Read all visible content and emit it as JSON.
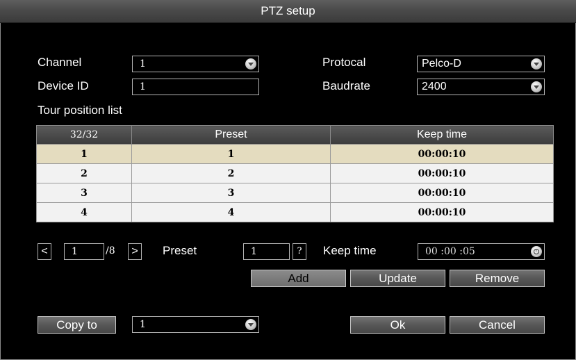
{
  "window": {
    "title": "PTZ setup"
  },
  "form": {
    "channel_label": "Channel",
    "channel_value": "1",
    "device_id_label": "Device ID",
    "device_id_value": "1",
    "protocol_label": "Protocal",
    "protocol_value": "Pelco-D",
    "baudrate_label": "Baudrate",
    "baudrate_value": "2400"
  },
  "tour": {
    "list_label": "Tour position list",
    "columns": [
      "32/32",
      "Preset",
      "Keep time"
    ],
    "rows": [
      {
        "index": "1",
        "preset": "1",
        "keep_time": "00:00:10",
        "selected": true
      },
      {
        "index": "2",
        "preset": "2",
        "keep_time": "00:00:10"
      },
      {
        "index": "3",
        "preset": "3",
        "keep_time": "00:00:10"
      },
      {
        "index": "4",
        "preset": "4",
        "keep_time": "00:00:10"
      }
    ]
  },
  "pager": {
    "prev": "<",
    "page": "1",
    "total": "/8",
    "next": ">"
  },
  "edit": {
    "preset_label": "Preset",
    "preset_value": "1",
    "help_glyph": "?",
    "keep_time_label": "Keep time",
    "keep_time_value": "00 :00 :05"
  },
  "actions": {
    "add": "Add",
    "update": "Update",
    "remove": "Remove"
  },
  "footer": {
    "copy_to_label": "Copy to",
    "copy_to_value": "1",
    "ok_label": "Ok",
    "cancel_label": "Cancel"
  },
  "icons": {
    "dropdown": "dropdown-arrow-icon",
    "clock": "clock-icon"
  },
  "colors": {
    "selected_row": "#e4dcbf",
    "row": "#f2f2f2",
    "title_bar": "#4a4a4a"
  }
}
